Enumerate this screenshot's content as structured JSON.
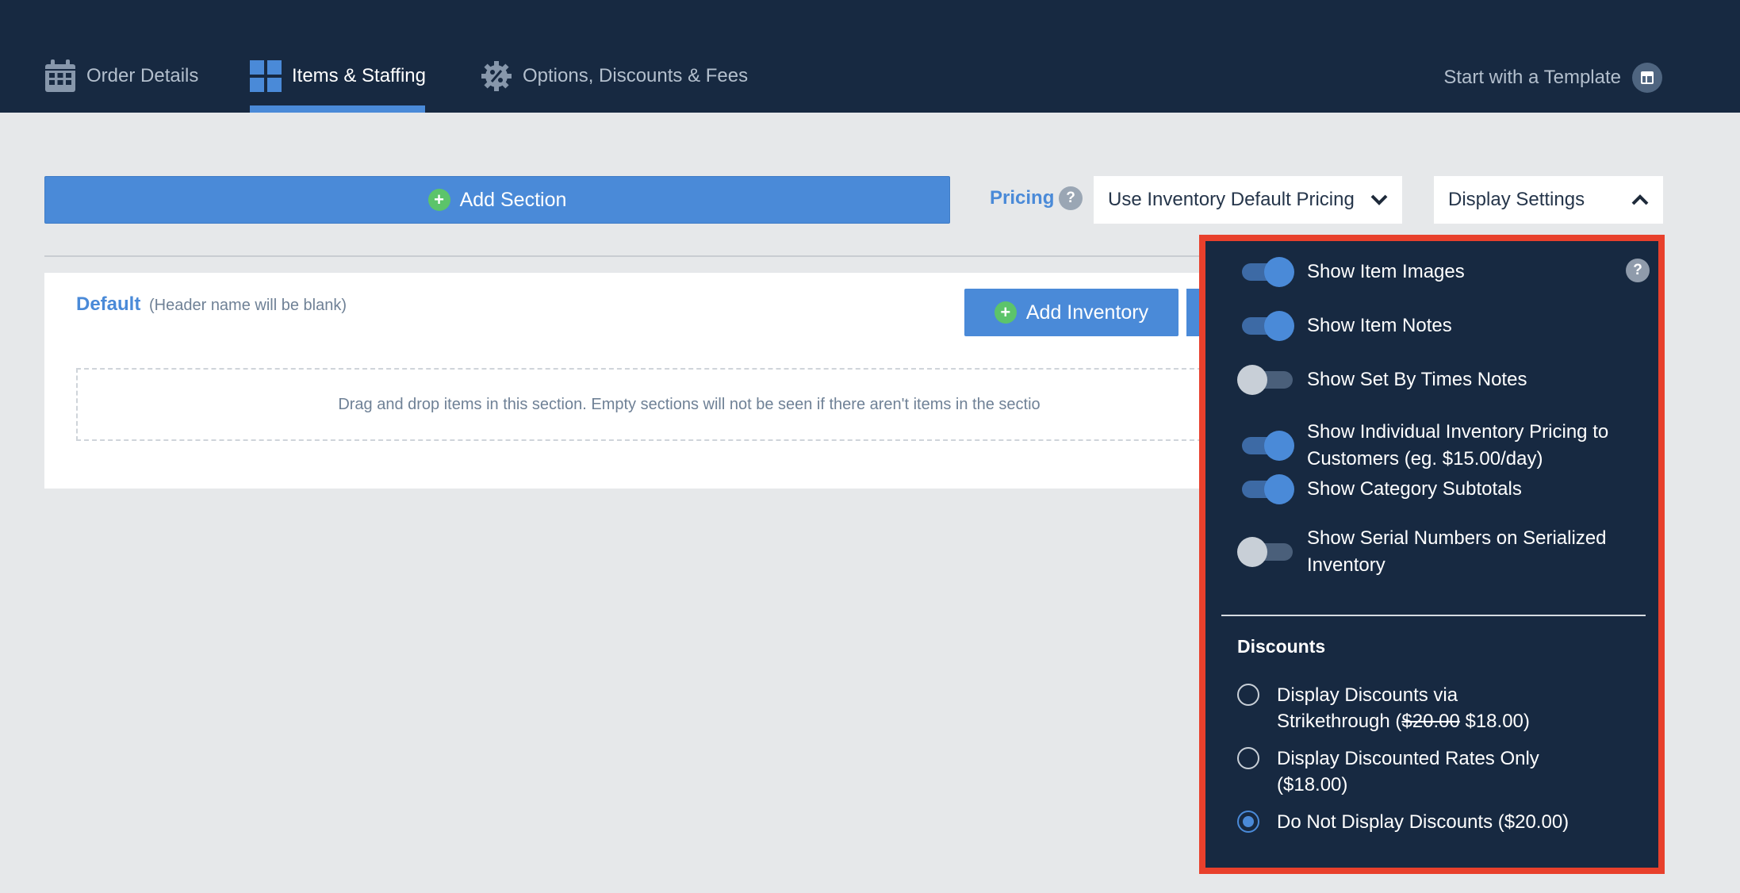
{
  "nav": {
    "tabs": [
      {
        "label": "Order Details",
        "icon": "calendar-icon"
      },
      {
        "label": "Items & Staffing",
        "icon": "grid-icon"
      },
      {
        "label": "Options, Discounts & Fees",
        "icon": "discount-gear-icon"
      }
    ],
    "active_tab": "Items & Staffing",
    "template_link": "Start with a Template"
  },
  "toolbar": {
    "add_section_label": "Add Section",
    "pricing_label": "Pricing",
    "pricing_help": "?",
    "pricing_value": "Use Inventory Default Pricing",
    "display_settings_label": "Display Settings"
  },
  "section": {
    "title": "Default",
    "subtitle": "(Header name will be blank)",
    "add_inventory_label": "Add Inventory",
    "dropzone_text": "Drag and drop items in this section. Empty sections will not be seen if there aren't items in the sectio"
  },
  "display_settings": {
    "help": "?",
    "toggles": [
      {
        "label": "Show Item Images",
        "on": true
      },
      {
        "label": "Show Item Notes",
        "on": true
      },
      {
        "label": "Show Set By Times Notes",
        "on": false
      },
      {
        "label": "Show Individual Inventory Pricing to Customers (eg. $15.00/day)",
        "on": true
      },
      {
        "label": "Show Category Subtotals",
        "on": true
      },
      {
        "label": "Show Serial Numbers on Serialized Inventory",
        "on": false
      }
    ],
    "discounts_title": "Discounts",
    "discount_options": [
      {
        "line1": "Display Discounts via",
        "line2_prefix": "Strikethrough (",
        "line2_strike": "$20.00",
        "line2_suffix": " $18.00)",
        "checked": false
      },
      {
        "line1": "Display Discounted Rates Only",
        "line2": "($18.00)",
        "checked": false
      },
      {
        "line1": "Do Not Display Discounts ($20.00)",
        "checked": true
      }
    ]
  },
  "colors": {
    "nav_bg": "#172941",
    "accent": "#4a8ad8",
    "highlight_border": "#e8402c",
    "plus_green": "#5cc46a"
  }
}
